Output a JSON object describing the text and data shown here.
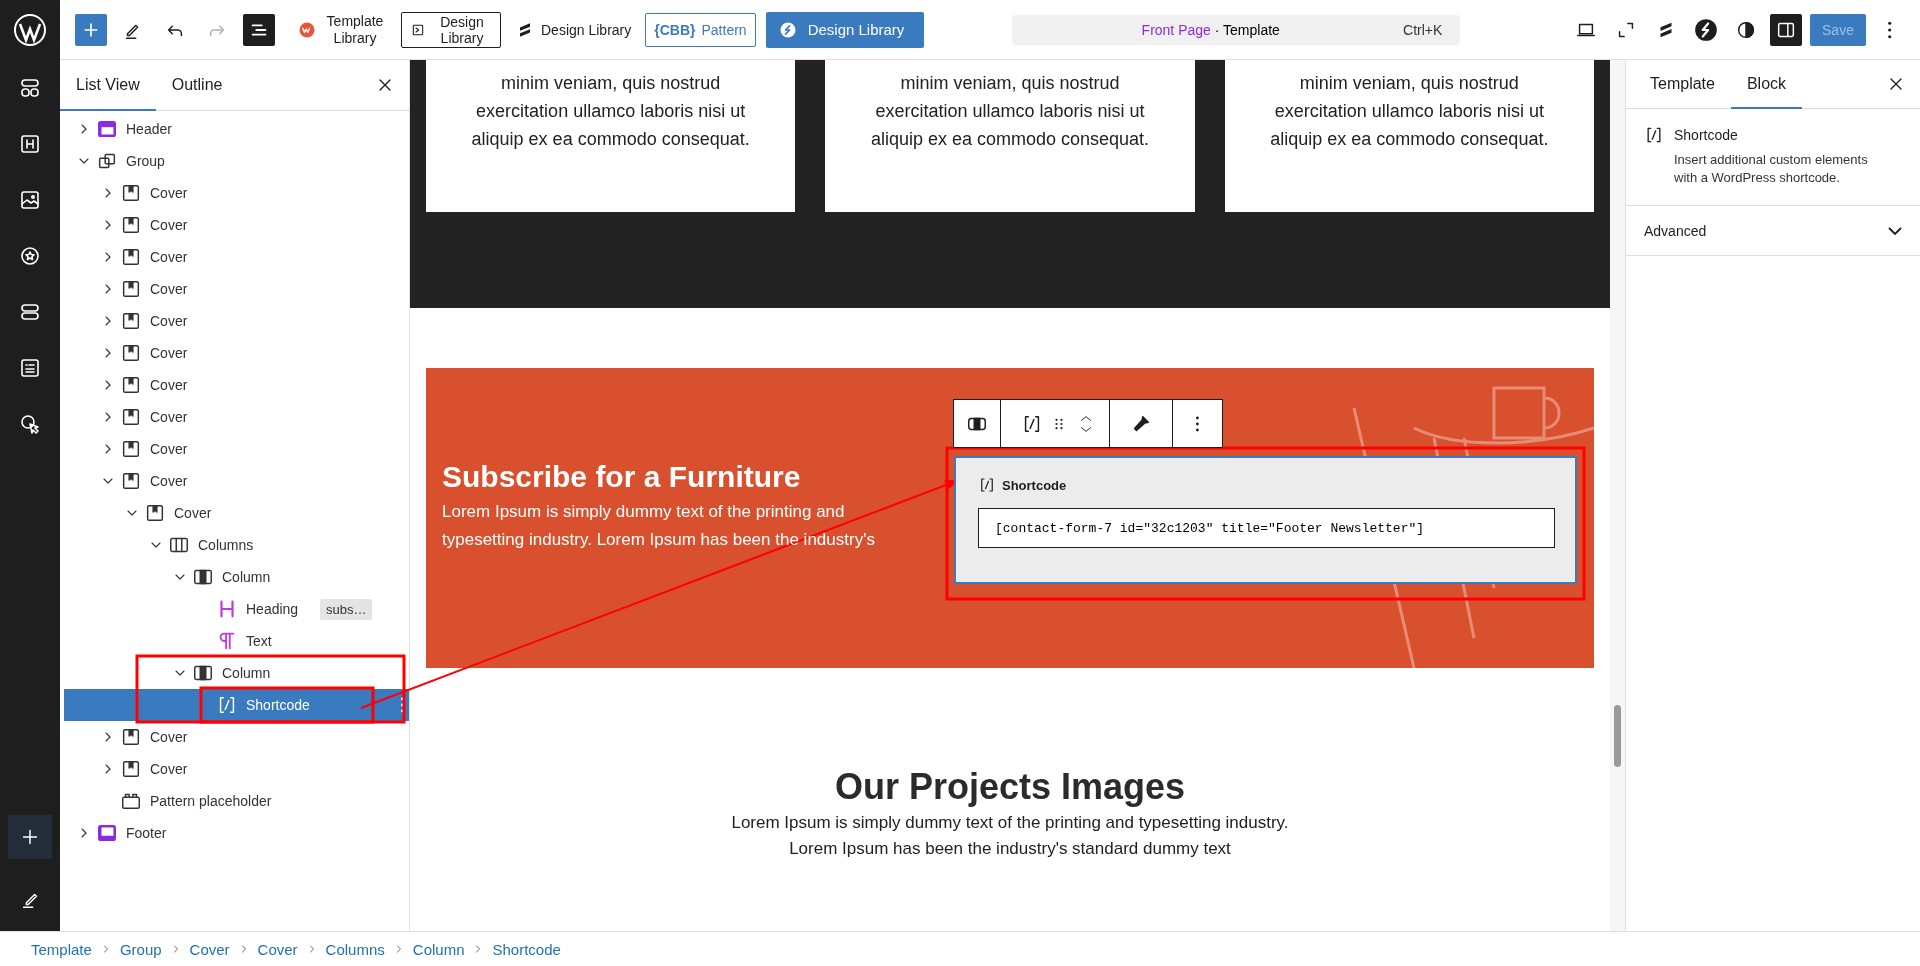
{
  "top_bar": {
    "left_tools": [
      {
        "kind": "add"
      },
      {
        "kind": "tools"
      },
      {
        "kind": "undo",
        "disabled": false
      },
      {
        "kind": "redo",
        "disabled": true
      },
      {
        "kind": "list-view",
        "selected": true
      }
    ],
    "plugins": [
      {
        "kind": "template-library",
        "label": "Template Library"
      },
      {
        "kind": "outlined",
        "label": "Design Library"
      },
      {
        "kind": "plain",
        "label": "Design Library"
      },
      {
        "kind": "cbb",
        "logo": "{CBB}",
        "label": "Pattern"
      },
      {
        "kind": "solid",
        "label": "Design Library"
      }
    ],
    "command": {
      "title": "Front Page",
      "suffix": "· Template",
      "shortcut": "Ctrl+K"
    },
    "right_tools": [
      {
        "kind": "preview",
        "selected": false
      },
      {
        "kind": "fullscreen",
        "selected": false
      },
      {
        "kind": "stackable",
        "selected": false
      },
      {
        "kind": "spectra",
        "selected": false
      },
      {
        "kind": "styles",
        "selected": false
      },
      {
        "kind": "settings",
        "selected": true
      }
    ],
    "save": {
      "label": "Save",
      "disabled": true
    }
  },
  "rail": [
    {
      "kind": "blocks"
    },
    {
      "kind": "heading"
    },
    {
      "kind": "image"
    },
    {
      "kind": "badge"
    },
    {
      "kind": "stack"
    },
    {
      "kind": "form"
    },
    {
      "kind": "cursor"
    }
  ],
  "list_view": {
    "tabs": [
      {
        "label": "List View",
        "selected": true
      },
      {
        "label": "Outline",
        "selected": false
      }
    ],
    "items": [
      {
        "label": "Header",
        "kind": "header",
        "expanded": false,
        "selected": false
      },
      {
        "label": "Group",
        "kind": "group",
        "expanded": true,
        "selected": false,
        "children": [
          {
            "label": "Cover",
            "kind": "cover",
            "expanded": false,
            "selected": false
          },
          {
            "label": "Cover",
            "kind": "cover",
            "expanded": false,
            "selected": false
          },
          {
            "label": "Cover",
            "kind": "cover",
            "expanded": false,
            "selected": false
          },
          {
            "label": "Cover",
            "kind": "cover",
            "expanded": false,
            "selected": false
          },
          {
            "label": "Cover",
            "kind": "cover",
            "expanded": false,
            "selected": false
          },
          {
            "label": "Cover",
            "kind": "cover",
            "expanded": false,
            "selected": false
          },
          {
            "label": "Cover",
            "kind": "cover",
            "expanded": false,
            "selected": false
          },
          {
            "label": "Cover",
            "kind": "cover",
            "expanded": false,
            "selected": false
          },
          {
            "label": "Cover",
            "kind": "cover",
            "expanded": false,
            "selected": false
          },
          {
            "label": "Cover",
            "kind": "cover",
            "expanded": true,
            "selected": false,
            "children": [
              {
                "label": "Cover",
                "kind": "cover",
                "expanded": true,
                "selected": false,
                "children": [
                  {
                    "label": "Columns",
                    "kind": "columns",
                    "expanded": true,
                    "selected": false,
                    "children": [
                      {
                        "label": "Column",
                        "kind": "column",
                        "expanded": true,
                        "selected": false,
                        "children": [
                          {
                            "label": "Heading",
                            "kind": "heading",
                            "selected": false,
                            "badge": "subs…"
                          },
                          {
                            "label": "Text",
                            "kind": "text",
                            "selected": false
                          }
                        ]
                      },
                      {
                        "label": "Column",
                        "kind": "column",
                        "expanded": true,
                        "selected": false,
                        "children": [
                          {
                            "label": "Shortcode",
                            "kind": "shortcode",
                            "selected": true
                          }
                        ]
                      }
                    ]
                  }
                ]
              }
            ]
          },
          {
            "label": "Cover",
            "kind": "cover",
            "expanded": false,
            "selected": false
          },
          {
            "label": "Cover",
            "kind": "cover",
            "expanded": false,
            "selected": false
          },
          {
            "label": "Pattern placeholder",
            "kind": "pattern",
            "selected": false
          }
        ]
      },
      {
        "label": "Footer",
        "kind": "footer",
        "expanded": false,
        "selected": false
      }
    ]
  },
  "canvas": {
    "cards": [
      {
        "text": "minim veniam, quis nostrud exercitation ullamco laboris nisi ut aliquip ex ea commodo consequat."
      },
      {
        "text": "minim veniam, quis nostrud exercitation ullamco laboris nisi ut aliquip ex ea commodo consequat."
      },
      {
        "text": "minim veniam, quis nostrud exercitation ullamco laboris nisi ut aliquip ex ea commodo consequat."
      }
    ],
    "subscribe": {
      "heading": "Subscribe for a Furniture",
      "text": "Lorem Ipsum is simply dummy text of the printing and typesetting industry. Lorem Ipsum has been the industry's"
    },
    "block_toolbar": [
      {
        "kind": "parent"
      },
      {
        "kind": "block"
      },
      {
        "kind": "style"
      },
      {
        "kind": "more"
      }
    ],
    "shortcode_block": {
      "label": "Shortcode",
      "value": "[contact-form-7 id=\"32c1203\" title=\"Footer Newsletter\"]"
    },
    "projects": {
      "heading": "Our Projects Images",
      "lines": [
        "Lorem Ipsum is simply dummy text of the printing and typesetting industry.",
        "Lorem Ipsum has been the industry's standard dummy text"
      ]
    }
  },
  "inspector": {
    "tabs": [
      {
        "label": "Template",
        "selected": false
      },
      {
        "label": "Block",
        "selected": true
      }
    ],
    "block": {
      "title": "Shortcode",
      "description": "Insert additional custom elements with a WordPress shortcode."
    },
    "panels": [
      {
        "label": "Advanced",
        "expanded": false
      }
    ]
  },
  "breadcrumb": [
    "Template",
    "Group",
    "Cover",
    "Cover",
    "Columns",
    "Column",
    "Shortcode"
  ]
}
